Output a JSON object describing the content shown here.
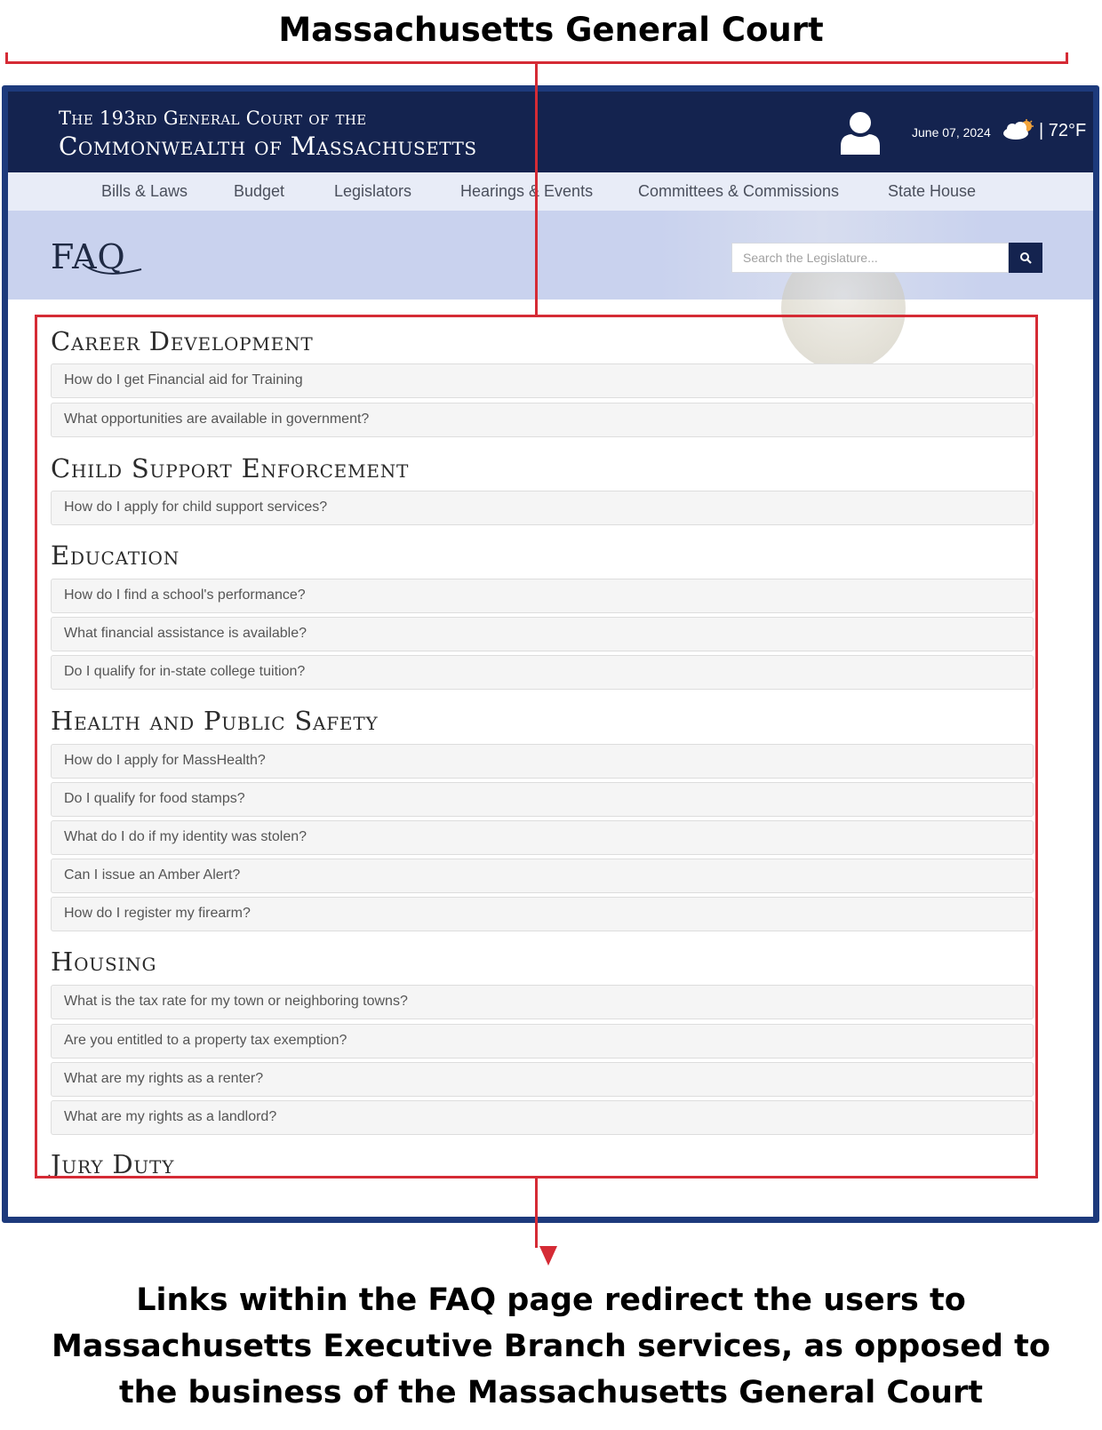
{
  "annotation": {
    "top_caption": "Massachusetts General Court",
    "bottom_caption": "Links within the FAQ page redirect the users to Massachusetts Executive Branch services, as opposed to the business of the Massachusetts General Court",
    "accent_color": "#d52b35"
  },
  "header": {
    "title_line1": "The 193rd General Court of the",
    "title_line2": "Commonwealth of Massachusetts",
    "user_icon": "user-icon",
    "date": "June 07, 2024",
    "weather_icon": "partly-cloudy-icon",
    "temperature": "| 72°F",
    "background_color": "#14234f"
  },
  "nav": {
    "items": [
      {
        "label": "Bills & Laws"
      },
      {
        "label": "Budget"
      },
      {
        "label": "Legislators"
      },
      {
        "label": "Hearings & Events"
      },
      {
        "label": "Committees & Commissions"
      },
      {
        "label": "State House"
      }
    ]
  },
  "hero": {
    "page_title": "FAQ",
    "search_placeholder": "Search the Legislature...",
    "search_icon": "search-icon"
  },
  "faq": {
    "sections": [
      {
        "heading": "Career Development",
        "questions": [
          "How do I get Financial aid for Training",
          "What opportunities are available in government?"
        ]
      },
      {
        "heading": "Child Support Enforcement",
        "questions": [
          "How do I apply for child support services?"
        ]
      },
      {
        "heading": "Education",
        "questions": [
          "How do I find a school's performance?",
          "What financial assistance is available?",
          "Do I qualify for in-state college tuition?"
        ]
      },
      {
        "heading": "Health and Public Safety",
        "questions": [
          "How do I apply for MassHealth?",
          "Do I qualify for food stamps?",
          "What do I do if my identity was stolen?",
          "Can I issue an Amber Alert?",
          "How do I register my firearm?"
        ]
      },
      {
        "heading": "Housing",
        "questions": [
          "What is the tax rate for my town or neighboring towns?",
          "Are you entitled to a property tax exemption?",
          "What are my rights as a renter?",
          "What are my rights as a landlord?"
        ]
      },
      {
        "heading": "Jury Duty",
        "questions": []
      }
    ]
  }
}
